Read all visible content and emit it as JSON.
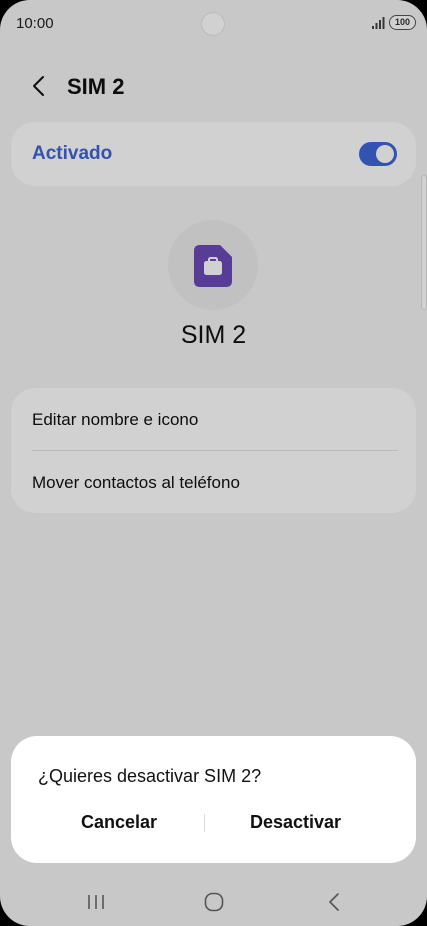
{
  "status_bar": {
    "time": "10:00",
    "battery": "100"
  },
  "header": {
    "title": "SIM 2"
  },
  "activated": {
    "label": "Activado",
    "enabled": true,
    "accent_color": "#3e66d6"
  },
  "sim": {
    "name": "SIM 2",
    "icon_color": "#6b4bb6"
  },
  "options": [
    {
      "label": "Editar nombre e icono"
    },
    {
      "label": "Mover contactos al teléfono"
    }
  ],
  "dialog": {
    "title": "¿Quieres desactivar SIM 2?",
    "cancel_label": "Cancelar",
    "confirm_label": "Desactivar"
  },
  "nav": {
    "recents_icon": "recents-icon",
    "home_icon": "home-icon",
    "back_icon": "back-icon"
  }
}
